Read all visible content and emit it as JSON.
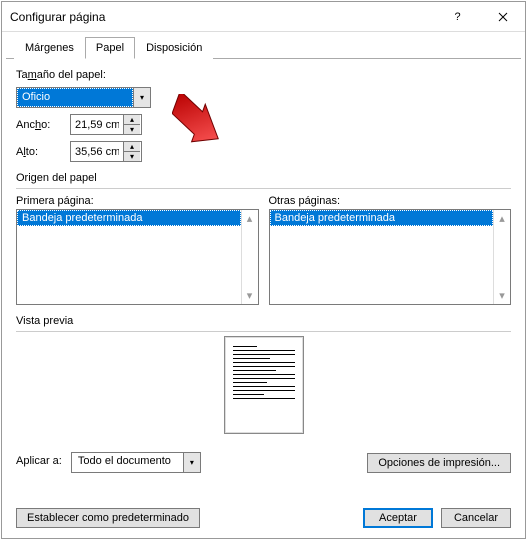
{
  "title": "Configurar página",
  "tabs": {
    "margins": "Márgenes",
    "paper": "Papel",
    "layout": "Disposición"
  },
  "paperSize": {
    "label": "Tamaño del papel:",
    "selected": "Oficio",
    "widthLabelPre": "Anc",
    "widthLabelU": "h",
    "widthLabelPost": "o:",
    "width": "21,59 cm",
    "heightLabelPre": "A",
    "heightLabelU": "l",
    "heightLabelPost": "to:",
    "height": "35,56 cm"
  },
  "source": {
    "label": "Origen del papel",
    "firstPage": "Primera página:",
    "otherPages": "Otras páginas:",
    "tray": "Bandeja predeterminada"
  },
  "preview": {
    "label": "Vista previa"
  },
  "applyTo": {
    "label": "Aplicar a:",
    "value": "Todo el documento"
  },
  "buttons": {
    "printOptions": "Opciones de impresión...",
    "setDefault": "Establecer como predeterminado",
    "ok": "Aceptar",
    "cancel": "Cancelar"
  }
}
